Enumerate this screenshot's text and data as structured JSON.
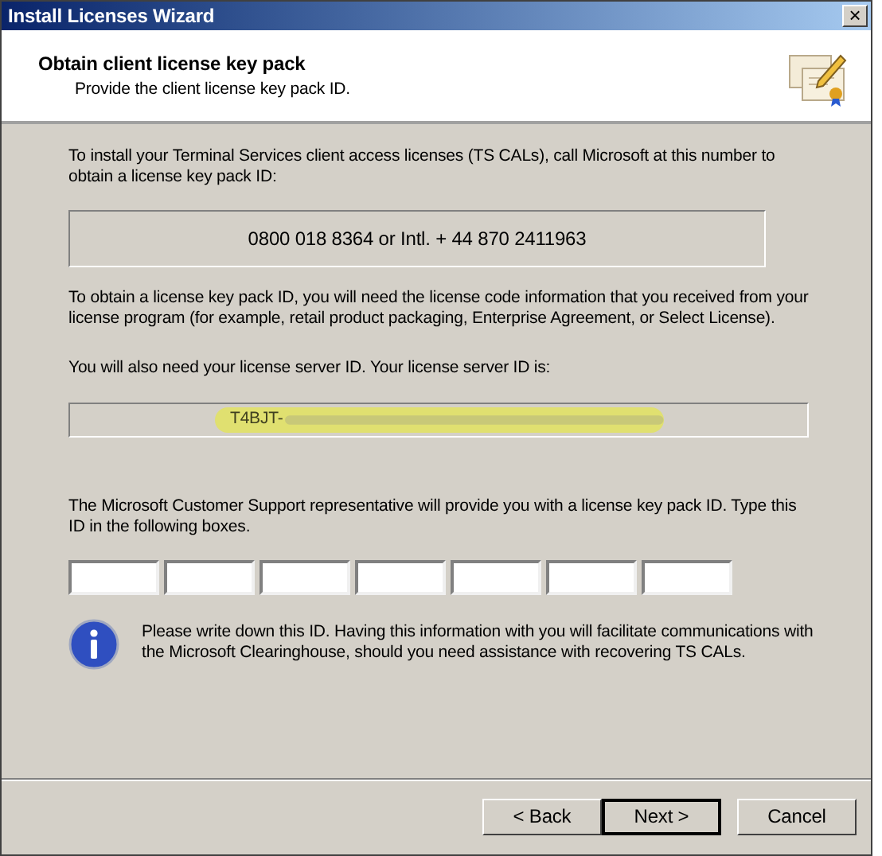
{
  "window": {
    "title": "Install Licenses Wizard",
    "close": "×"
  },
  "header": {
    "title": "Obtain client license key pack",
    "subtitle": "Provide the client license key pack ID."
  },
  "intro": "To install your Terminal Services client access licenses (TS CALs), call Microsoft at this number to obtain a license key pack ID:",
  "phone": "0800 018 8364 or Intl. + 44 870 2411963",
  "info_text": "To obtain a license key pack ID, you will need the license code information that you received from your license program (for example, retail product packaging, Enterprise Agreement, or Select License).",
  "server_label": "You will also need your license server ID. Your license server ID is:",
  "server_id": "T4BJT-",
  "instructions": "The Microsoft Customer Support representative will provide you with a license key pack ID. Type this ID in the following boxes.",
  "key_fields": [
    {
      "kind": "text"
    },
    {
      "kind": "text"
    },
    {
      "kind": "text"
    },
    {
      "kind": "text"
    },
    {
      "kind": "text"
    },
    {
      "kind": "text"
    },
    {
      "kind": "text"
    }
  ],
  "note": "Please write down this ID. Having this information with you will facilitate communications with the Microsoft Clearinghouse, should you need assistance with recovering TS CALs.",
  "buttons": [
    {
      "label": "< Back",
      "default": false
    },
    {
      "label": "Next >",
      "default": true
    },
    {
      "label": "Cancel",
      "default": false
    }
  ]
}
